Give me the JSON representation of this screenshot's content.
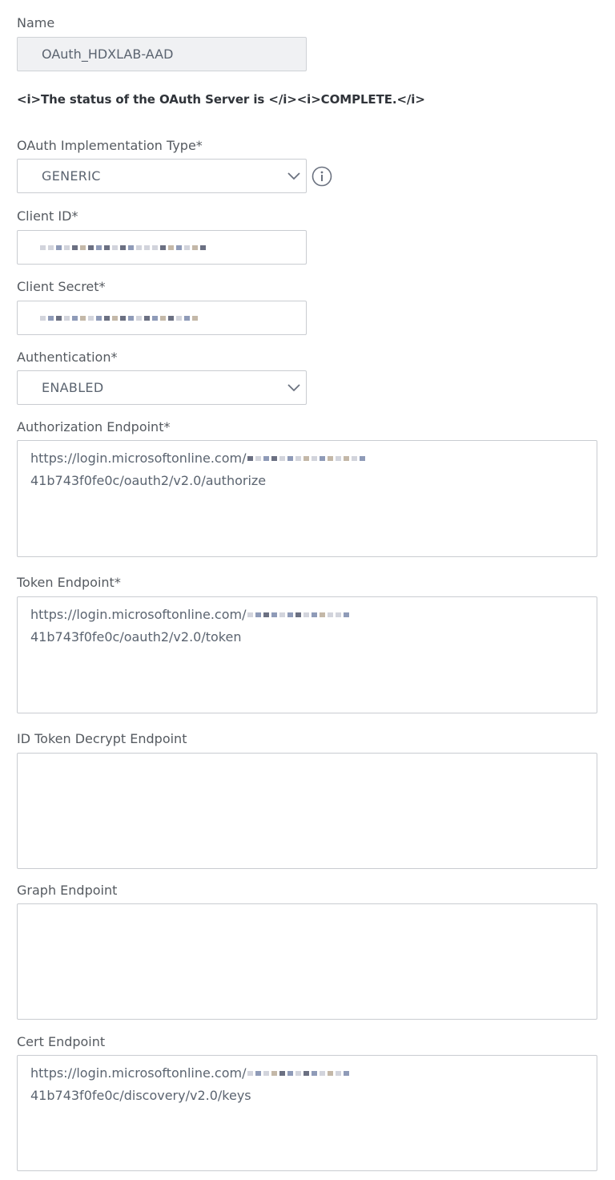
{
  "name": {
    "label": "Name",
    "value": "OAuth_HDXLAB-AAD"
  },
  "status_text": "<i>The status of the OAuth Server is </i><i>COMPLETE.</i>",
  "implementation_type": {
    "label": "OAuth Implementation Type*",
    "value": "GENERIC",
    "icon": "info-circle-icon"
  },
  "client_id": {
    "label": "Client ID*"
  },
  "client_secret": {
    "label": "Client Secret*"
  },
  "authentication": {
    "label": "Authentication*",
    "value": "ENABLED"
  },
  "authorization_endpoint": {
    "label": "Authorization Endpoint*",
    "line1": "https://login.microsoftonline.com/",
    "line2": "41b743f0fe0c/oauth2/v2.0/authorize"
  },
  "token_endpoint": {
    "label": "Token Endpoint*",
    "line1": "https://login.microsoftonline.com/",
    "line2": "41b743f0fe0c/oauth2/v2.0/token"
  },
  "id_token_decrypt_endpoint": {
    "label": "ID Token Decrypt Endpoint",
    "value": ""
  },
  "graph_endpoint": {
    "label": "Graph Endpoint",
    "value": ""
  },
  "cert_endpoint": {
    "label": "Cert Endpoint",
    "line1": "https://login.microsoftonline.com/",
    "line2": "41b743f0fe0c/discovery/v2.0/keys"
  },
  "colors": {
    "border": "#c9ccd1",
    "disabled_bg": "#f0f1f3",
    "label": "#555a60",
    "value": "#5b6470"
  }
}
